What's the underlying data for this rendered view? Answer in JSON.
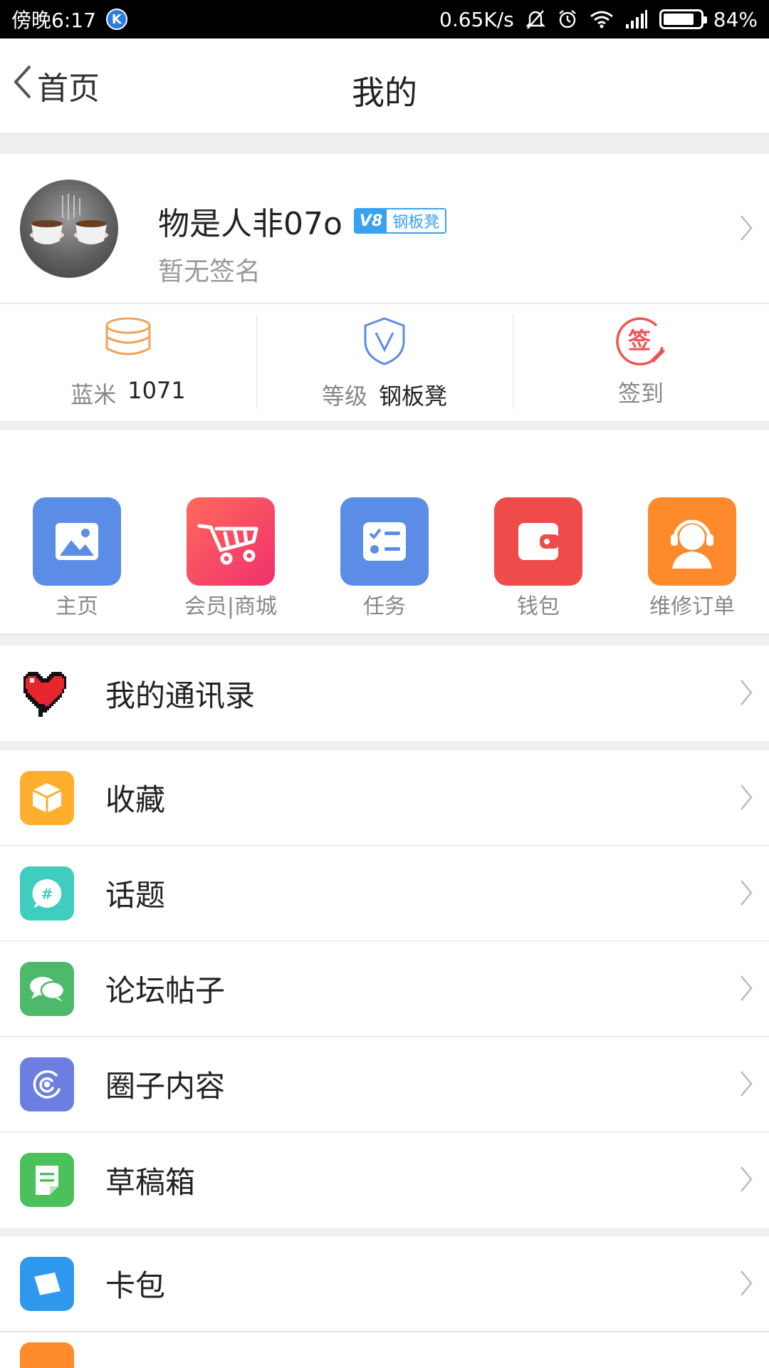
{
  "status_bar": {
    "time": "傍晚6:17",
    "app_badge": "K",
    "net_speed": "0.65K/s",
    "battery_percent_text": "84%",
    "battery_level": 0.84
  },
  "header": {
    "back_label": "首页",
    "title": "我的"
  },
  "profile": {
    "username": "物是人非07o",
    "badge_level": "V8",
    "badge_text": "钢板凳",
    "signature": "暂无签名"
  },
  "stats": [
    {
      "label": "蓝米",
      "value": "1071",
      "icon": "coins-icon"
    },
    {
      "label": "等级",
      "value": "钢板凳",
      "icon": "shield-v-icon"
    },
    {
      "label": "签到",
      "value": "",
      "icon": "sign-in-icon",
      "glyph": "签"
    }
  ],
  "shortcuts": [
    {
      "label": "主页",
      "icon": "picture-icon",
      "color": "#5b8de6"
    },
    {
      "label": "会员|商城",
      "icon": "cart-icon",
      "color": "#f24b66"
    },
    {
      "label": "任务",
      "icon": "checklist-icon",
      "color": "#5b8de6"
    },
    {
      "label": "钱包",
      "icon": "wallet-icon",
      "color": "#f04b4b"
    },
    {
      "label": "维修订单",
      "icon": "headset-user-icon",
      "color": "#ff8a2b"
    }
  ],
  "contacts": {
    "label": "我的通讯录",
    "icon": "pixel-heart-icon"
  },
  "menu": [
    {
      "label": "收藏",
      "icon": "box-icon",
      "color": "#ffae2e"
    },
    {
      "label": "话题",
      "icon": "hashtag-bubble-icon",
      "color": "#3ecdbe"
    },
    {
      "label": "论坛帖子",
      "icon": "chat-bubbles-icon",
      "color": "#4cb96b"
    },
    {
      "label": "圈子内容",
      "icon": "circle-swirl-icon",
      "color": "#6c7fe0"
    },
    {
      "label": "草稿箱",
      "icon": "note-icon",
      "color": "#4cc05a"
    }
  ],
  "menu2": [
    {
      "label": "卡包",
      "icon": "card-icon",
      "color": "#2e98ee"
    }
  ],
  "partial_icon_color": "#ff8a2b"
}
